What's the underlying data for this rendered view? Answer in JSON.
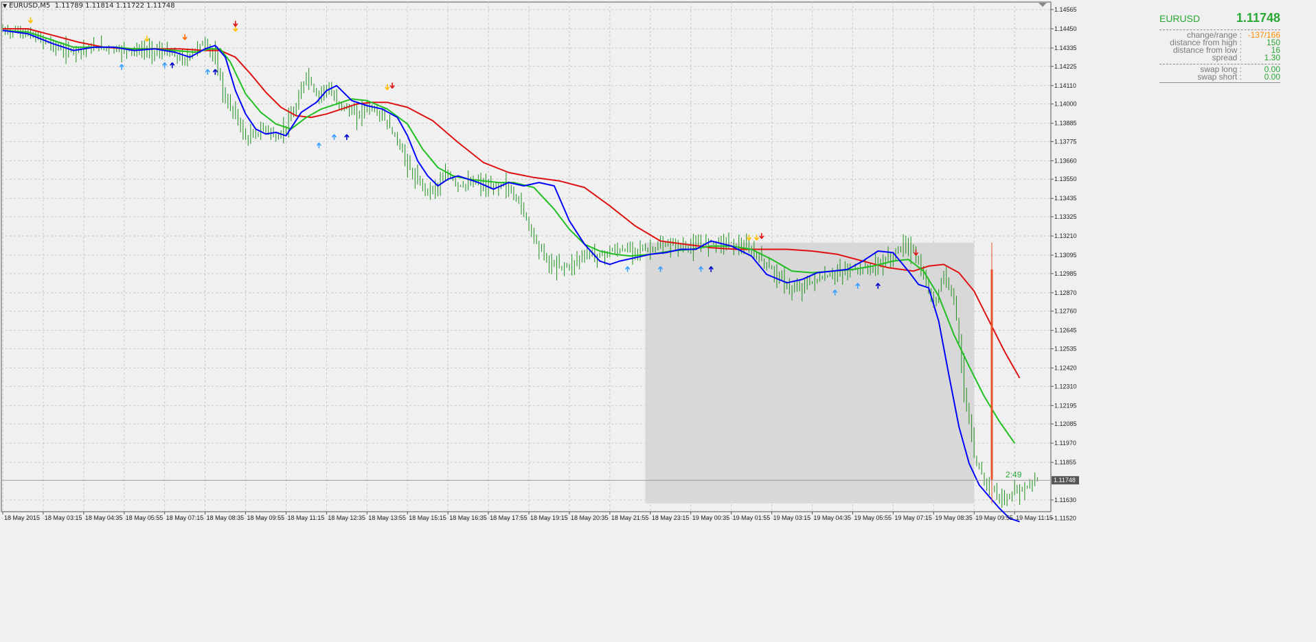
{
  "window": {
    "symbol_title": "EURUSD,M5",
    "ohlc_text": "1.11789 1.11814 1.11722 1.11748"
  },
  "info_panel": {
    "symbol": "EURUSD",
    "price": "1.11748",
    "rows": [
      {
        "label": "change/range :",
        "value": "-137/166",
        "color": "#ff8c00"
      },
      {
        "label": "distance from high :",
        "value": "150",
        "color": "#2aa835"
      },
      {
        "label": "distance from low :",
        "value": "16",
        "color": "#2aa835"
      },
      {
        "label": "spread :",
        "value": "1.30",
        "color": "#2aa835"
      }
    ],
    "swap_rows": [
      {
        "label": "swap long :",
        "value": "0.00"
      },
      {
        "label": "swap short :",
        "value": "0.00"
      }
    ]
  },
  "timer_text": "2:49",
  "chart_data": {
    "type": "line",
    "symbol": "EURUSD",
    "timeframe": "M5",
    "ylim": [
      1.1156,
      1.1461
    ],
    "y_ticks": [
      "1.14565",
      "1.14450",
      "1.14335",
      "1.14225",
      "1.14110",
      "1.14000",
      "1.13885",
      "1.13775",
      "1.13660",
      "1.13550",
      "1.13435",
      "1.13325",
      "1.13210",
      "1.13095",
      "1.12985",
      "1.12870",
      "1.12760",
      "1.12645",
      "1.12535",
      "1.12420",
      "1.12310",
      "1.12195",
      "1.12085",
      "1.11970",
      "1.11855",
      "1.11630",
      "1.11520"
    ],
    "y_tick_values": [
      1.14565,
      1.1445,
      1.14335,
      1.14225,
      1.1411,
      1.14,
      1.13885,
      1.13775,
      1.1366,
      1.1355,
      1.13435,
      1.13325,
      1.1321,
      1.13095,
      1.12985,
      1.1287,
      1.1276,
      1.12645,
      1.12535,
      1.1242,
      1.1231,
      1.12195,
      1.12085,
      1.1197,
      1.11855,
      1.1163,
      1.1152
    ],
    "current_price_label": "1.11748",
    "current_price": 1.11748,
    "x_ticks": [
      "18 May 2015",
      "18 May 03:15",
      "18 May 04:35",
      "18 May 05:55",
      "18 May 07:15",
      "18 May 08:35",
      "18 May 09:55",
      "18 May 11:15",
      "18 May 12:35",
      "18 May 13:55",
      "18 May 15:15",
      "18 May 16:35",
      "18 May 17:55",
      "18 May 19:15",
      "18 May 20:35",
      "18 May 21:55",
      "18 May 23:15",
      "19 May 00:35",
      "19 May 01:55",
      "19 May 03:15",
      "19 May 04:35",
      "19 May 05:55",
      "19 May 07:15",
      "19 May 08:35",
      "19 May 09:55",
      "19 May 11:15"
    ],
    "x_tick_bar_index": [
      0,
      16,
      32,
      48,
      64,
      80,
      96,
      112,
      128,
      144,
      160,
      176,
      192,
      208,
      224,
      240,
      256,
      272,
      288,
      304,
      320,
      336,
      352,
      368,
      384,
      400
    ],
    "total_bars": 410,
    "ma_fast_blue": {
      "color": "#0000ff",
      "bar_index": [
        0,
        10,
        20,
        28,
        36,
        44,
        52,
        60,
        68,
        74,
        80,
        84,
        88,
        92,
        96,
        100,
        104,
        108,
        112,
        118,
        124,
        128,
        132,
        138,
        144,
        150,
        156,
        160,
        164,
        168,
        172,
        176,
        180,
        184,
        188,
        194,
        200,
        206,
        212,
        218,
        224,
        230,
        236,
        240,
        244,
        250,
        256,
        262,
        268,
        274,
        280,
        288,
        296,
        302,
        310,
        316,
        322,
        328,
        334,
        340,
        346,
        352,
        358,
        362,
        366,
        370,
        374,
        378,
        382,
        386,
        390,
        394,
        398,
        402
      ],
      "values": [
        1.1444,
        1.1442,
        1.1436,
        1.1432,
        1.1434,
        1.1434,
        1.1432,
        1.1433,
        1.1431,
        1.1428,
        1.1433,
        1.1435,
        1.1428,
        1.1408,
        1.1394,
        1.1385,
        1.1382,
        1.1383,
        1.1381,
        1.1395,
        1.1401,
        1.1408,
        1.1411,
        1.1402,
        1.1399,
        1.1397,
        1.1392,
        1.1381,
        1.1366,
        1.1357,
        1.1351,
        1.1355,
        1.1357,
        1.1355,
        1.1353,
        1.1349,
        1.1353,
        1.1351,
        1.1353,
        1.1351,
        1.133,
        1.1316,
        1.1306,
        1.1304,
        1.1306,
        1.1308,
        1.131,
        1.1311,
        1.1313,
        1.1313,
        1.1318,
        1.1315,
        1.1309,
        1.1298,
        1.1293,
        1.1295,
        1.1299,
        1.13,
        1.1301,
        1.1306,
        1.1312,
        1.1311,
        1.13,
        1.1292,
        1.129,
        1.127,
        1.1238,
        1.1207,
        1.1185,
        1.1172,
        1.1165,
        1.1158,
        1.1152,
        1.115
      ]
    },
    "ma_mid_green": {
      "color": "#1fbf1f",
      "bar_index": [
        0,
        10,
        20,
        28,
        36,
        44,
        52,
        60,
        68,
        76,
        82,
        86,
        90,
        96,
        102,
        108,
        114,
        120,
        126,
        132,
        138,
        144,
        152,
        160,
        166,
        172,
        178,
        184,
        190,
        196,
        202,
        210,
        218,
        224,
        230,
        236,
        242,
        248,
        256,
        264,
        272,
        280,
        288,
        296,
        304,
        312,
        320,
        328,
        336,
        344,
        352,
        358,
        364,
        370,
        376,
        382,
        388,
        394,
        400
      ],
      "values": [
        1.1444,
        1.1443,
        1.1438,
        1.1434,
        1.1434,
        1.1434,
        1.1433,
        1.1433,
        1.1432,
        1.1431,
        1.1433,
        1.1433,
        1.1425,
        1.1406,
        1.1395,
        1.1388,
        1.1385,
        1.1392,
        1.1397,
        1.14,
        1.1403,
        1.1402,
        1.1397,
        1.1388,
        1.1373,
        1.1362,
        1.1357,
        1.1355,
        1.1354,
        1.1353,
        1.1353,
        1.135,
        1.1337,
        1.1325,
        1.1316,
        1.1312,
        1.131,
        1.1309,
        1.131,
        1.1312,
        1.1313,
        1.1315,
        1.1315,
        1.1313,
        1.1307,
        1.13,
        1.1299,
        1.13,
        1.1301,
        1.1303,
        1.1306,
        1.1307,
        1.13,
        1.1285,
        1.1262,
        1.1243,
        1.1225,
        1.121,
        1.1197
      ]
    },
    "ma_slow_red": {
      "color": "#e01010",
      "bar_index": [
        0,
        10,
        20,
        30,
        40,
        50,
        60,
        70,
        80,
        86,
        92,
        98,
        104,
        110,
        116,
        122,
        128,
        134,
        140,
        146,
        152,
        160,
        170,
        180,
        190,
        200,
        210,
        220,
        230,
        240,
        250,
        260,
        270,
        280,
        290,
        300,
        310,
        320,
        330,
        340,
        350,
        360,
        366,
        372,
        378,
        384,
        390,
        396,
        402
      ],
      "values": [
        1.1445,
        1.1445,
        1.1441,
        1.1437,
        1.1434,
        1.1433,
        1.1433,
        1.1433,
        1.1432,
        1.1432,
        1.1428,
        1.1418,
        1.1407,
        1.1398,
        1.1393,
        1.1392,
        1.1394,
        1.1397,
        1.14,
        1.1401,
        1.1401,
        1.1398,
        1.139,
        1.1377,
        1.1365,
        1.1359,
        1.1356,
        1.1354,
        1.135,
        1.1339,
        1.1327,
        1.1318,
        1.1316,
        1.1314,
        1.1313,
        1.1313,
        1.1313,
        1.1312,
        1.131,
        1.1306,
        1.1302,
        1.13,
        1.1303,
        1.1304,
        1.1299,
        1.1288,
        1.127,
        1.1252,
        1.1236
      ]
    },
    "price_path": {
      "color": "#1e8f1e",
      "bar_index": [
        0,
        8,
        16,
        24,
        32,
        40,
        48,
        56,
        64,
        72,
        76,
        80,
        84,
        88,
        92,
        96,
        100,
        104,
        108,
        112,
        116,
        120,
        124,
        128,
        132,
        136,
        140,
        144,
        150,
        156,
        162,
        168,
        172,
        176,
        180,
        184,
        188,
        192,
        198,
        204,
        210,
        216,
        220,
        224,
        228,
        232,
        236,
        240,
        248,
        256,
        264,
        272,
        280,
        288,
        296,
        304,
        312,
        320,
        328,
        336,
        344,
        352,
        356,
        360,
        364,
        368,
        372,
        376,
        380,
        384,
        388,
        392,
        396,
        400,
        404,
        408
      ],
      "values": [
        1.1444,
        1.1443,
        1.1438,
        1.1432,
        1.1433,
        1.1434,
        1.1432,
        1.1432,
        1.1431,
        1.1426,
        1.1433,
        1.1437,
        1.1427,
        1.1402,
        1.1394,
        1.1379,
        1.1382,
        1.1386,
        1.1379,
        1.1387,
        1.1398,
        1.1418,
        1.1405,
        1.141,
        1.1401,
        1.1397,
        1.1393,
        1.1399,
        1.1393,
        1.1378,
        1.1357,
        1.1348,
        1.1351,
        1.1358,
        1.1351,
        1.1352,
        1.1353,
        1.1349,
        1.1352,
        1.1342,
        1.132,
        1.1304,
        1.1303,
        1.1303,
        1.1308,
        1.1311,
        1.1309,
        1.1312,
        1.1313,
        1.1313,
        1.1316,
        1.1314,
        1.1318,
        1.1317,
        1.1312,
        1.1301,
        1.1288,
        1.1294,
        1.1298,
        1.1301,
        1.1302,
        1.1309,
        1.1316,
        1.1312,
        1.1296,
        1.128,
        1.1298,
        1.1285,
        1.123,
        1.1188,
        1.1175,
        1.1168,
        1.1162,
        1.1168,
        1.117,
        1.1175
      ]
    },
    "selection_rect": {
      "from_bar": 254,
      "to_bar": 384,
      "y_from": 1.1317,
      "y_to": 1.1161,
      "color": "#d8d8d8"
    },
    "range_bar": {
      "bar_index": 391,
      "y_high": 1.1317,
      "y_low": 1.1161,
      "bar_top": 1.1301,
      "bar_bottom": 1.1175,
      "color": "#e8502a"
    },
    "signals_up": [
      {
        "bar": 47,
        "y": 1.1427,
        "color": "#3aa0ff"
      },
      {
        "bar": 64,
        "y": 1.1428,
        "color": "#3aa0ff"
      },
      {
        "bar": 67,
        "y": 1.1428,
        "color": "#0000cc"
      },
      {
        "bar": 81,
        "y": 1.1424,
        "color": "#3aa0ff"
      },
      {
        "bar": 84,
        "y": 1.1424,
        "color": "#0000cc"
      },
      {
        "bar": 125,
        "y": 1.138,
        "color": "#3aa0ff"
      },
      {
        "bar": 131,
        "y": 1.1385,
        "color": "#3aa0ff"
      },
      {
        "bar": 136,
        "y": 1.1385,
        "color": "#0000cc"
      },
      {
        "bar": 247,
        "y": 1.1306,
        "color": "#3aa0ff"
      },
      {
        "bar": 260,
        "y": 1.1306,
        "color": "#3aa0ff"
      },
      {
        "bar": 276,
        "y": 1.1306,
        "color": "#3aa0ff"
      },
      {
        "bar": 280,
        "y": 1.1306,
        "color": "#0000cc"
      },
      {
        "bar": 329,
        "y": 1.1292,
        "color": "#3aa0ff"
      },
      {
        "bar": 338,
        "y": 1.1296,
        "color": "#3aa0ff"
      },
      {
        "bar": 346,
        "y": 1.1296,
        "color": "#0000cc"
      }
    ],
    "signals_down": [
      {
        "bar": 11,
        "y": 1.1446,
        "color": "#ffbf00"
      },
      {
        "bar": 57,
        "y": 1.1435,
        "color": "#ffbf00"
      },
      {
        "bar": 72,
        "y": 1.1436,
        "color": "#ff6a00"
      },
      {
        "bar": 92,
        "y": 1.1441,
        "color": "#ffbf00"
      },
      {
        "bar": 92,
        "y": 1.1444,
        "color": "#e01010"
      },
      {
        "bar": 152,
        "y": 1.1406,
        "color": "#ffbf00"
      },
      {
        "bar": 154,
        "y": 1.1407,
        "color": "#e01010"
      },
      {
        "bar": 295,
        "y": 1.1316,
        "color": "#ffbf00"
      },
      {
        "bar": 298,
        "y": 1.1316,
        "color": "#ffbf00"
      },
      {
        "bar": 300,
        "y": 1.1317,
        "color": "#e01010"
      },
      {
        "bar": 361,
        "y": 1.1307,
        "color": "#e01010"
      }
    ]
  }
}
